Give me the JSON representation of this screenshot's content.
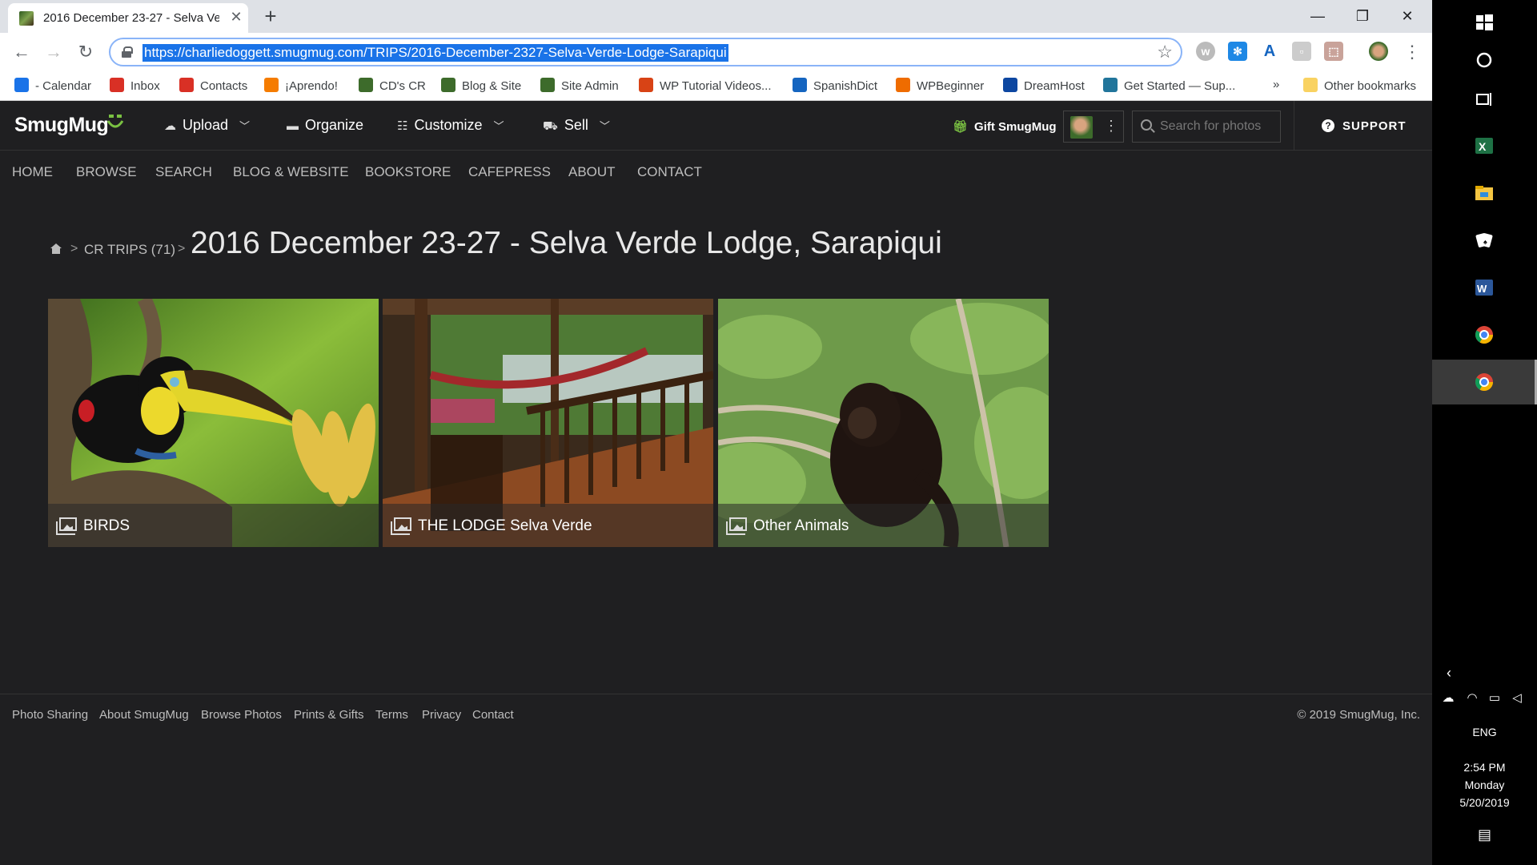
{
  "browser": {
    "tab_title": "2016 December 23-27 - Selva Ve",
    "url": "https://charliedoggett.smugmug.com/TRIPS/2016-December-2327-Selva-Verde-Lodge-Sarapiqui",
    "bookmarks": [
      {
        "label": "- Calendar",
        "icon": "calendar-icon",
        "color": "#1a73e8"
      },
      {
        "label": "Inbox",
        "icon": "gmail-icon",
        "color": "#d93025"
      },
      {
        "label": "Contacts",
        "icon": "gmail-icon",
        "color": "#d93025"
      },
      {
        "label": "¡Aprendo!",
        "icon": "blogger-icon",
        "color": "#f57c00"
      },
      {
        "label": "CD's CR",
        "icon": "photo-icon",
        "color": "#3d6b2b"
      },
      {
        "label": "Blog & Site",
        "icon": "photo-icon",
        "color": "#3d6b2b"
      },
      {
        "label": "Site Admin",
        "icon": "photo-icon",
        "color": "#3d6b2b"
      },
      {
        "label": "WP Tutorial Videos...",
        "icon": "wp-tutorial-icon",
        "color": "#d84315"
      },
      {
        "label": "SpanishDict",
        "icon": "spanishdict-icon",
        "color": "#1565c0"
      },
      {
        "label": "WPBeginner",
        "icon": "wpbeginner-icon",
        "color": "#ef6c00"
      },
      {
        "label": "DreamHost",
        "icon": "dreamhost-icon",
        "color": "#0d47a1"
      },
      {
        "label": "Get Started — Sup...",
        "icon": "wordpress-icon",
        "color": "#21759b"
      }
    ],
    "overflow_label": "»",
    "other_bookmarks": "Other bookmarks"
  },
  "site": {
    "logo": "SmugMug",
    "menu": [
      {
        "label": "Upload",
        "icon": "cloud-upload-icon",
        "dropdown": true
      },
      {
        "label": "Organize",
        "icon": "folder-icon",
        "dropdown": false
      },
      {
        "label": "Customize",
        "icon": "sliders-icon",
        "dropdown": true
      },
      {
        "label": "Sell",
        "icon": "cart-icon",
        "dropdown": true
      }
    ],
    "gift": "Gift SmugMug",
    "search_placeholder": "Search for photos",
    "support": "SUPPORT",
    "nav": [
      "HOME",
      "BROWSE",
      "SEARCH",
      "BLOG & WEBSITE",
      "BOOKSTORE",
      "CAFEPRESS",
      "ABOUT",
      "CONTACT"
    ],
    "breadcrumb": {
      "link": "CR TRIPS (71)",
      "sep": ">"
    },
    "page_title": "2016 December 23-27 - Selva Verde Lodge, Sarapiqui",
    "galleries": [
      {
        "title": "BIRDS",
        "image": "toucan-photo"
      },
      {
        "title": "THE LODGE Selva Verde",
        "image": "porch-hammock-photo"
      },
      {
        "title": "Other Animals",
        "image": "howler-monkey-photo"
      }
    ],
    "footer": [
      "Photo Sharing",
      "About SmugMug",
      "Browse Photos",
      "Prints & Gifts",
      "Terms",
      "Privacy",
      "Contact"
    ],
    "copyright": "© 2019 SmugMug, Inc."
  },
  "taskbar": {
    "language": "ENG",
    "time": "2:54 PM",
    "day": "Monday",
    "date": "5/20/2019"
  }
}
